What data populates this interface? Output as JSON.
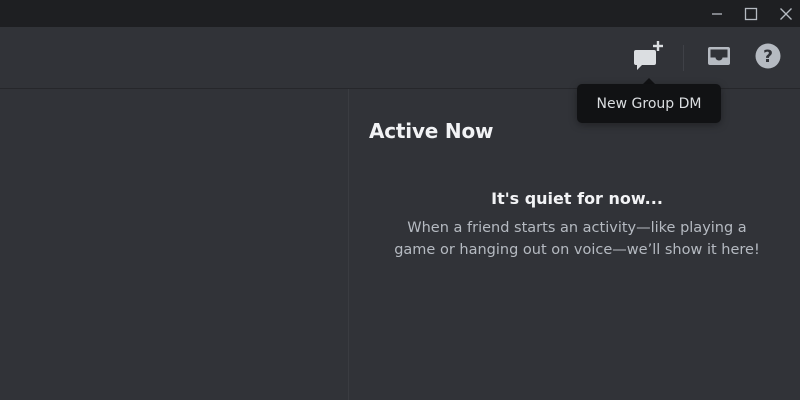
{
  "window_controls": {
    "minimize_icon": "minimize-icon",
    "maximize_icon": "maximize-icon",
    "close_icon": "close-icon"
  },
  "header": {
    "new_group_dm_icon": "new-group-dm-icon",
    "inbox_icon": "inbox-icon",
    "help_icon": "help-icon"
  },
  "tooltip": {
    "text": "New Group DM"
  },
  "active_now": {
    "title": "Active Now",
    "empty_title": "It's quiet for now...",
    "empty_description": "When a friend starts an activity—like playing a game or hanging out on voice—we’ll show it here!"
  },
  "colors": {
    "background": "#313338",
    "titlebar": "#1e1f22",
    "tooltip_bg": "#111214",
    "text_primary": "#f2f3f5",
    "text_muted": "#b5bac1",
    "icon": "#b5bac1"
  }
}
